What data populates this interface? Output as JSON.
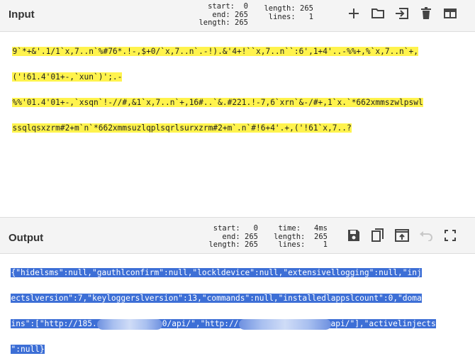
{
  "input": {
    "title": "Input",
    "stats": {
      "start_label": "start:",
      "start": "0",
      "end_label": "end:",
      "end": "265",
      "sel_length_label": "length:",
      "sel_length": "265",
      "length_label": "length:",
      "length": "265",
      "lines_label": "lines:",
      "lines": "1"
    },
    "toolbar": [
      "plus-icon",
      "folder-icon",
      "import-file-icon",
      "trash-icon",
      "layout-icon"
    ],
    "lines": [
      "9`*+&'.1/1`x,7..n`%#76*.!-,$+0/`x,7..n`.-!).&'4+!``x,7..n``:6',1+4'..-%%+,%`x,7..n`+,",
      "('!61.4'01+-,`xun`)';.-",
      "%%'01.4'01+-,`xsqn`!-//#,&1`x,7..n`+,16#..`&.#221.!-7,6`xrn`&-/#+,1`x.`*662xmmszwlpswl",
      "ssqlqsxzrm#2+m`n`*662xmmsuzlqplsqrlsurxzrm#2+m`.n`#!6+4'.+,('!61`x,7..?"
    ]
  },
  "output": {
    "title": "Output",
    "stats": {
      "start_label": "start:",
      "start": "0",
      "time_label": "time:",
      "time": "4ms",
      "end_label": "end:",
      "end": "265",
      "length_label": "length:",
      "length": "265",
      "length2_label": "length:",
      "length2": "265",
      "lines_label": "lines:",
      "lines": "1"
    },
    "toolbar": [
      "save-icon",
      "copy-icon",
      "replace-input-icon",
      "undo-icon",
      "maximize-icon"
    ],
    "line1": "{\"hidelsms\":null,\"gauthlconfirm\":null,\"lockldevice\":null,\"extensivellogging\":null,\"inj",
    "line2": "ectslversion\":7,\"keyloggerslversion\":13,\"commands\":null,\"installedlappslcount\":0,\"doma",
    "line3_a": "ins\":[\"http://185.",
    "line3_b": "0/api/\",\"http://",
    "line3_c": "api/\"],\"activelinjects",
    "line4": "\":null}"
  },
  "colors": {
    "header_bg": "#f4f4f4",
    "input_highlight": "#fff34d",
    "output_selection": "#3d6fd6"
  }
}
